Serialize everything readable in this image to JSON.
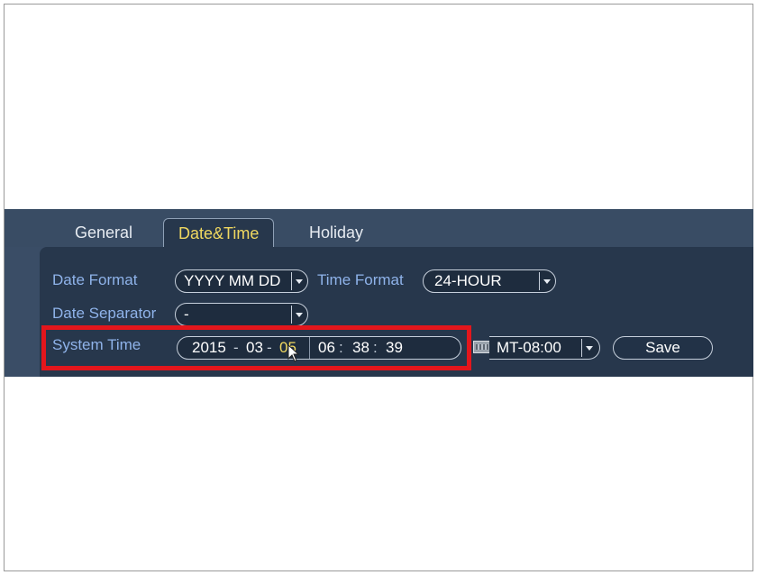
{
  "tabs": {
    "general": "General",
    "datetime": "Date&Time",
    "holiday": "Holiday"
  },
  "date_format": {
    "label": "Date Format",
    "value": "YYYY MM DD"
  },
  "time_format": {
    "label": "Time Format",
    "value": "24-HOUR"
  },
  "date_separator": {
    "label": "Date Separator",
    "value": "-"
  },
  "system_time": {
    "label": "System Time",
    "year": "2015",
    "month": "03",
    "day": "05",
    "hour": "06",
    "minute": "38",
    "second": "39",
    "date_sep": "-",
    "time_sep": ":"
  },
  "timezone": {
    "value": "MT-08:00"
  },
  "save_label": "Save",
  "colors": {
    "panel_bg": "#3a4d66",
    "content_bg": "#27374c",
    "label": "#8fb3ea",
    "active_tab_text": "#f0d860",
    "highlight_box": "#e3161c"
  },
  "icons": {
    "dropdown": "chevron-down-icon",
    "keyboard": "keyboard-icon",
    "cursor": "mouse-pointer-icon"
  }
}
